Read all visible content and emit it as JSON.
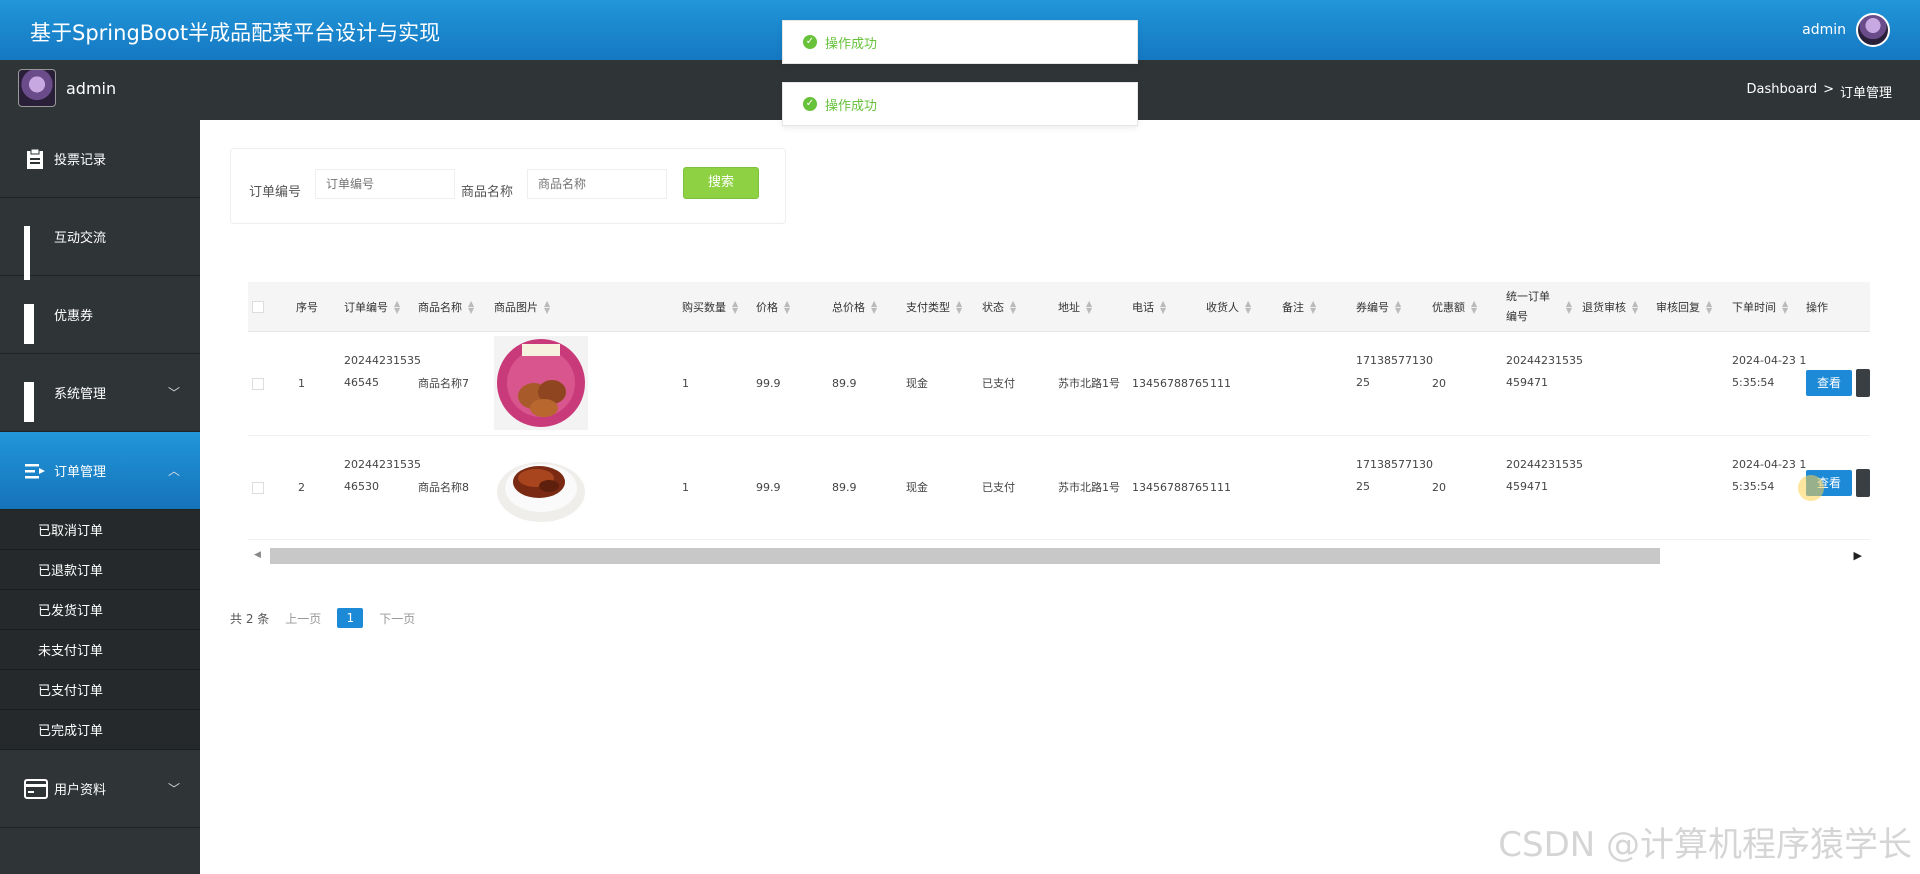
{
  "header": {
    "title": "基于SpringBoot半成品配菜平台设计与实现",
    "user": "admin"
  },
  "subbar": {
    "user": "admin",
    "breadcrumb": [
      "Dashboard",
      ">",
      "订单管理"
    ]
  },
  "toasts": [
    "操作成功",
    "操作成功"
  ],
  "sidebar": {
    "items": [
      {
        "label": "投票记录",
        "icon": "clipboard-icon"
      },
      {
        "label": "互动交流",
        "icon": "grid-icon"
      },
      {
        "label": "优惠券",
        "icon": "grid4-icon"
      },
      {
        "label": "系统管理",
        "icon": "grid4-icon",
        "chevron": "chevron-down-icon"
      },
      {
        "label": "订单管理",
        "icon": "list-icon",
        "chevron": "chevron-up-icon",
        "active": true
      },
      {
        "label": "用户资料",
        "icon": "card-icon",
        "chevron": "chevron-down-icon"
      }
    ],
    "submenu": [
      "已取消订单",
      "已退款订单",
      "已发货订单",
      "未支付订单",
      "已支付订单",
      "已完成订单"
    ]
  },
  "search": {
    "order_label": "订单编号",
    "order_placeholder": "订单编号",
    "product_label": "商品名称",
    "product_placeholder": "商品名称",
    "button": "搜索"
  },
  "table": {
    "headers": [
      "序号",
      "订单编号",
      "商品名称",
      "商品图片",
      "购买数量",
      "价格",
      "总价格",
      "支付类型",
      "状态",
      "地址",
      "电话",
      "收货人",
      "备注",
      "券编号",
      "优惠额",
      "统一订单编号",
      "退货审核",
      "审核回复",
      "下单时间",
      "操作"
    ],
    "rows": [
      {
        "index": "1",
        "order_no_1": "20244231535",
        "order_no_2": "46545",
        "product": "商品名称7",
        "image": "food-image-chicken",
        "qty": "1",
        "price": "99.9",
        "total": "89.9",
        "pay": "现金",
        "status": "已支付",
        "address": "苏市北路1号",
        "phone": "13456788765",
        "receiver": "111",
        "note": "",
        "coupon_1": "17138577130",
        "coupon_2": "25",
        "discount": "20",
        "unified_1": "20244231535",
        "unified_2": "459471",
        "time_1": "2024-04-23 1",
        "time_2": "5:35:54",
        "action": "查看"
      },
      {
        "index": "2",
        "order_no_1": "20244231535",
        "order_no_2": "46530",
        "product": "商品名称8",
        "image": "food-image-braised-pork",
        "qty": "1",
        "price": "99.9",
        "total": "89.9",
        "pay": "现金",
        "status": "已支付",
        "address": "苏市北路1号",
        "phone": "13456788765",
        "receiver": "111",
        "note": "",
        "coupon_1": "17138577130",
        "coupon_2": "25",
        "discount": "20",
        "unified_1": "20244231535",
        "unified_2": "459471",
        "time_1": "2024-04-23 1",
        "time_2": "5:35:54",
        "action": "查看"
      }
    ]
  },
  "pager": {
    "total": "共 2 条",
    "prev": "上一页",
    "current": "1",
    "next": "下一页"
  },
  "watermark": "CSDN @计算机程序猿学长",
  "colors": {
    "header": "#1e88d0",
    "sidebar": "#2f3437",
    "active": "#1c8ad6",
    "search_btn": "#8ed244",
    "toast": "#67c23a"
  }
}
